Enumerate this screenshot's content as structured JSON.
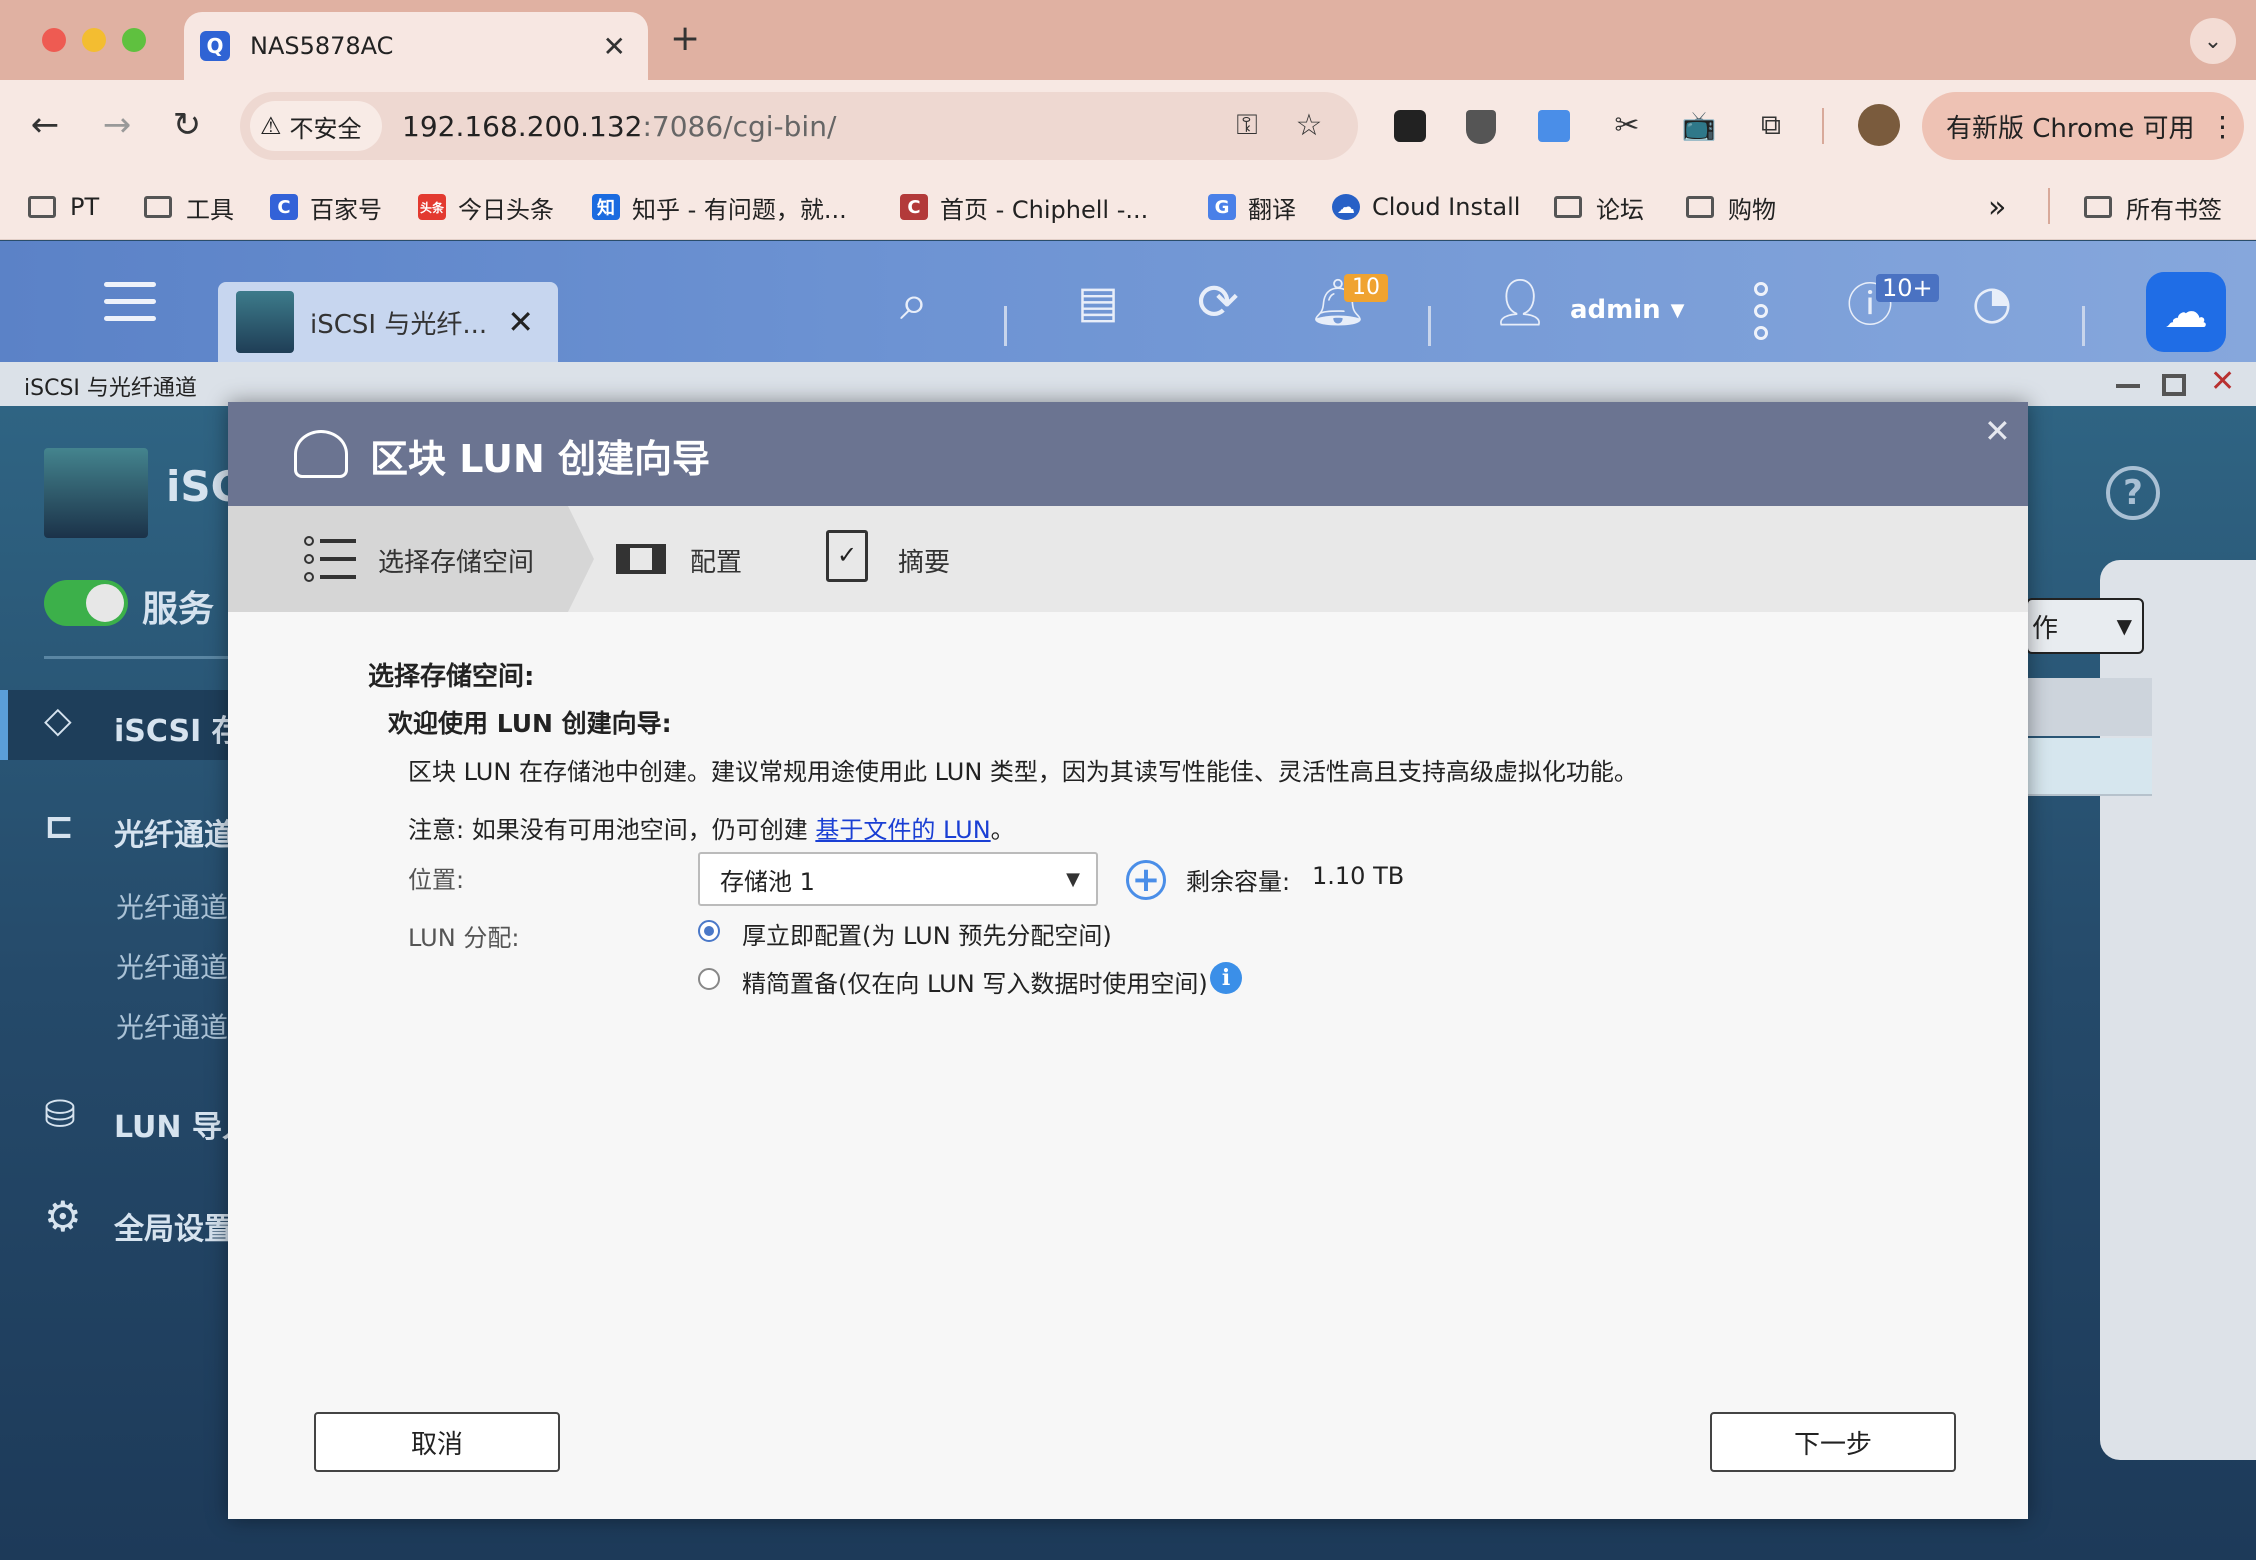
{
  "browser": {
    "tab_title": "NAS5878AC",
    "security_label": "不安全",
    "url_host": "192.168.200.132",
    "url_rest": ":7086/cgi-bin/",
    "update_label": "有新版 Chrome 可用",
    "bookmarks": [
      "PT",
      "工具",
      "百家号",
      "今日头条",
      "知乎 - 有问题，就...",
      "首页 - Chiphell -...",
      "翻译",
      "Cloud Install",
      "论坛",
      "购物"
    ],
    "all_bookmarks": "所有书签",
    "overflow": "»"
  },
  "qnap": {
    "app_tab": "iSCSI 与光纤...",
    "user": "admin",
    "notif_count": "10",
    "info_count": "10+",
    "window_title": "iSCSI 与光纤通道",
    "app_name_partial": "iSC",
    "service_label": "服务",
    "sidebar": {
      "iscsi": "iSCSI 存",
      "fc": "光纤通道",
      "fc_sub": [
        "光纤通道",
        "光纤通道",
        "光纤通道"
      ],
      "lun_import": "LUN 导入",
      "global": "全局设置"
    },
    "action_partial": "作"
  },
  "wizard": {
    "title": "区块 LUN 创建向导",
    "steps": [
      "选择存储空间",
      "配置",
      "摘要"
    ],
    "section_title": "选择存储空间:",
    "welcome": "欢迎使用 LUN 创建向导:",
    "desc": "区块 LUN 在存储池中创建。建议常规用途使用此 LUN 类型，因为其读写性能佳、灵活性高且支持高级虚拟化功能。",
    "note_prefix": "注意: 如果没有可用池空间，仍可创建 ",
    "note_link": "基于文件的 LUN",
    "note_suffix": "。",
    "location_label": "位置:",
    "location_value": "存储池 1",
    "remaining_label": "剩余容量:",
    "remaining_value": "1.10 TB",
    "lun_alloc_label": "LUN 分配:",
    "option_thick": "厚立即配置(为 LUN 预先分配空间)",
    "option_thin": "精简置备(仅在向 LUN 写入数据时使用空间)",
    "cancel": "取消",
    "next": "下一步"
  }
}
